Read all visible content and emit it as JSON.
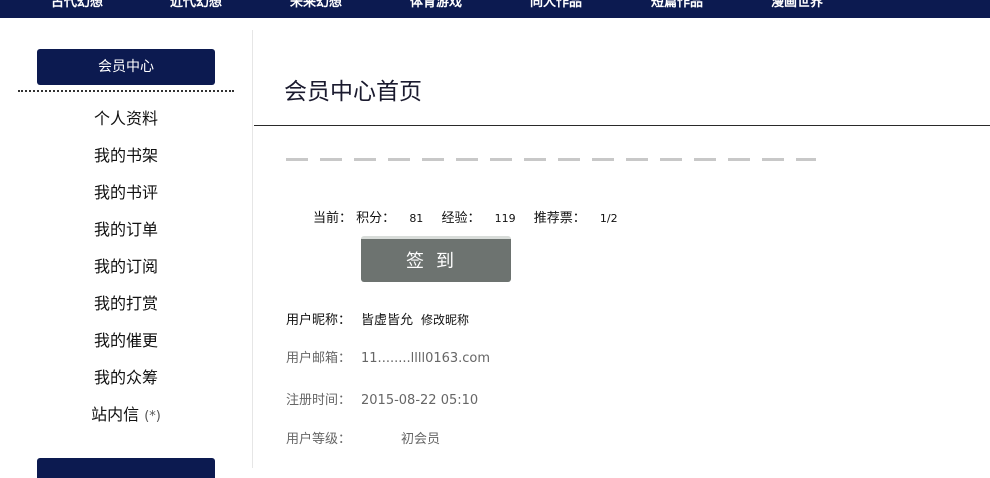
{
  "topnav": {
    "items": [
      "古代幻想",
      "近代幻想",
      "未来幻想",
      "体育游戏",
      "同人作品",
      "短篇作品",
      "漫画世界"
    ]
  },
  "sidebar": {
    "header": "会员中心",
    "items": [
      {
        "label": "个人资料"
      },
      {
        "label": "我的书架"
      },
      {
        "label": "我的书评"
      },
      {
        "label": "我的订单"
      },
      {
        "label": "我的订阅"
      },
      {
        "label": "我的打赏"
      },
      {
        "label": "我的催更"
      },
      {
        "label": "我的众筹"
      },
      {
        "label": "站内信",
        "badge": "(*)"
      }
    ]
  },
  "main": {
    "title": "会员中心首页",
    "stats": {
      "current_label": "当前：",
      "points_label": "积分：",
      "points": "81",
      "exp_label": "经验：",
      "exp": "119",
      "votes_label": "推荐票：",
      "votes": "1/2"
    },
    "checkin_label": "签到",
    "nickname": {
      "label": "用户昵称：",
      "value": "皆虚皆允",
      "edit": "修改昵称"
    },
    "email": {
      "label": "用户邮箱：",
      "value": "11........llll0163.com"
    },
    "register_time": {
      "label": "注册时间：",
      "value": "2015-08-22 05:10"
    },
    "level": {
      "label": "用户等级：",
      "value": "初会员"
    }
  },
  "colors": {
    "nav_bg": "#0c1a50",
    "button_gray": "#6d7370"
  }
}
